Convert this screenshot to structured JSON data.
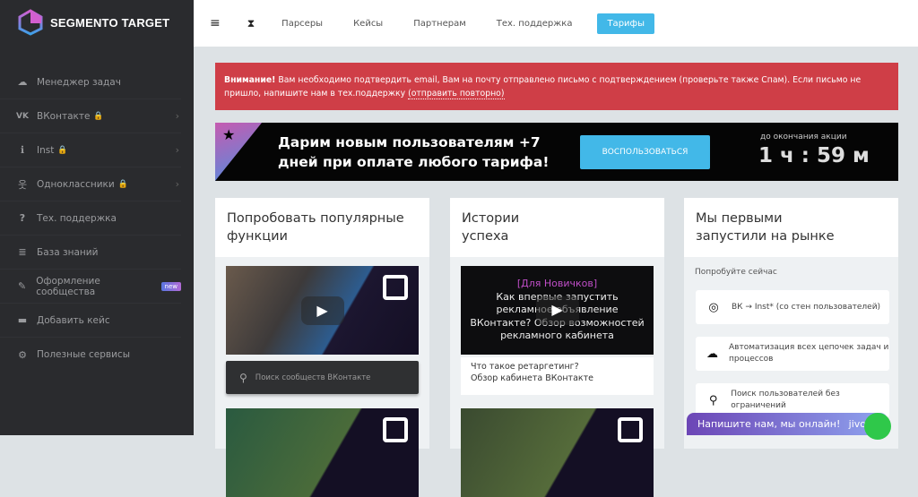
{
  "brand": {
    "name": "SEGMENTO TARGET"
  },
  "sidebar": {
    "items": [
      {
        "label": "Менеджер задач",
        "icon": "cloud-icon"
      },
      {
        "label": "ВКонтакте",
        "icon": "vk-icon",
        "locked": true,
        "chevron": true
      },
      {
        "label": "Inst",
        "icon": "info-icon",
        "locked": true,
        "chevron": true
      },
      {
        "label": "Одноклассники",
        "icon": "ok-icon",
        "locked": true,
        "chevron": true
      },
      {
        "label": "Тех. поддержка",
        "icon": "question-icon"
      },
      {
        "label": "База знаний",
        "icon": "database-icon"
      },
      {
        "label": "Оформление сообщества",
        "icon": "brush-icon",
        "badge": "new"
      },
      {
        "label": "Добавить кейс",
        "icon": "briefcase-icon"
      },
      {
        "label": "Полезные сервисы",
        "icon": "gears-icon"
      }
    ]
  },
  "topnav": {
    "items": [
      "Парсеры",
      "Кейсы",
      "Партнерам",
      "Тех. поддержка"
    ],
    "tariffs": "Тарифы"
  },
  "alert": {
    "strong": "Внимание!",
    "text": " Вам необходимо подтвердить email, Вам на почту отправлено письмо с подтверждением (проверьте также Спам). Если письмо не пришло, напишите нам в тех.поддержку ",
    "link": "(отправить повторно)"
  },
  "promo": {
    "line1": "Дарим новым пользователям +7",
    "line2": "дней при оплате любого тарифа!",
    "button": "ВОСПОЛЬЗОВАТЬСЯ",
    "countdown_label": "до окончания акции",
    "countdown": "1 ч : 59 м"
  },
  "cards": {
    "popular": {
      "title1": "Попробовать популярные",
      "title2": "функции",
      "search": "Поиск сообществ ВКонтакте"
    },
    "stories": {
      "title1": "Истории",
      "title2": "успеха",
      "video_tag": "[Для Новичков]",
      "video_text": "Как впервые запустить рекламное объявление ВКонтакте? Обзор возможностей рекламного кабинета",
      "caption1": "Что такое ретаргетинг?",
      "caption2": "Обзор кабинета ВКонтакте"
    },
    "first": {
      "title1": "Мы первыми",
      "title2": "запустили на рынке",
      "try": "Попробуйте сейчас",
      "features": [
        {
          "label": "ВК → Inst* (со стен пользователей)",
          "icon": "instagram-icon"
        },
        {
          "label": "Автоматизация всех цепочек задач и процессов",
          "icon": "cloud-icon"
        },
        {
          "label": "Поиск пользователей без ограничений",
          "icon": "search-icon"
        }
      ]
    }
  },
  "chat": {
    "label": "Напишите нам, мы онлайн!",
    "logo": "jivo"
  }
}
